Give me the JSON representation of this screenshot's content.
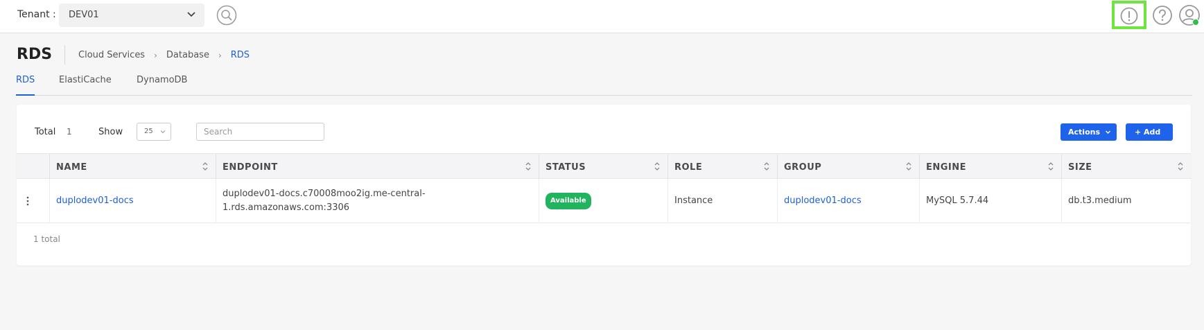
{
  "header": {
    "tenant_label": "Tenant :",
    "tenant_value": "DEV01"
  },
  "page": {
    "title": "RDS",
    "breadcrumb": [
      "Cloud Services",
      "Database",
      "RDS"
    ]
  },
  "tabs": [
    {
      "label": "RDS",
      "active": true
    },
    {
      "label": "ElastiCache",
      "active": false
    },
    {
      "label": "DynamoDB",
      "active": false
    }
  ],
  "toolbar": {
    "total_label": "Total",
    "total_count": "1",
    "show_label": "Show",
    "show_value": "25",
    "search_placeholder": "Search",
    "actions_label": "Actions",
    "add_label": "+ Add"
  },
  "table": {
    "columns": [
      "NAME",
      "ENDPOINT",
      "STATUS",
      "ROLE",
      "GROUP",
      "ENGINE",
      "SIZE"
    ],
    "rows": [
      {
        "name": "duplodev01-docs",
        "endpoint_line1": "duplodev01-docs.c70008moo2ig.me-central-",
        "endpoint_line2": "1.rds.amazonaws.com:3306",
        "status": "Available",
        "role": "Instance",
        "group": "duplodev01-docs",
        "engine": "MySQL 5.7.44",
        "size": "db.t3.medium"
      }
    ]
  },
  "footer": {
    "total_text": "1 total"
  },
  "colors": {
    "accent": "#1e63e9",
    "status_available": "#22b35e",
    "highlight": "#6ee43f"
  },
  "icons": {
    "search": "search-icon",
    "alert": "alert-icon",
    "help": "help-icon",
    "user": "user-icon"
  }
}
